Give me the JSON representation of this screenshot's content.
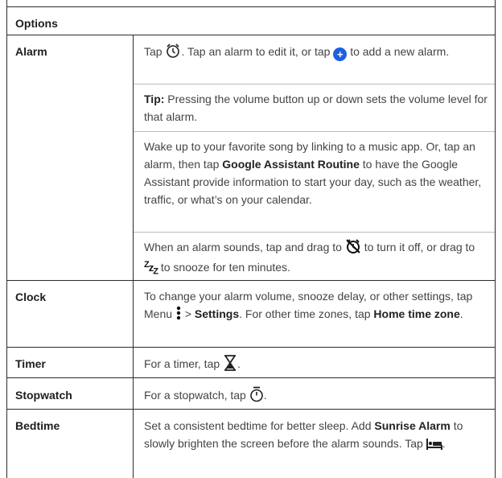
{
  "header": {
    "title": "Options"
  },
  "rows": {
    "alarm": {
      "label": "Alarm",
      "p1_a": "Tap ",
      "p1_b": ". Tap an alarm to edit it, or tap ",
      "p1_c": " to add a new alarm.",
      "tip_label": "Tip:",
      "tip_text": " Pressing the volume button up or down sets the volume level for that alarm.",
      "p3_a": "Wake up to your favorite song by linking to a music app. Or, tap an alarm, then tap ",
      "p3_bold": "Google Assistant Routine",
      "p3_b": " to have the Google Assistant provide information to start your day, such as the weather, traffic, or what’s on your calendar.",
      "p4_a": "When an alarm sounds, tap and drag to ",
      "p4_b": " to turn it off, or drag to ",
      "p4_c": " to snooze for ten minutes."
    },
    "clock": {
      "label": "Clock",
      "a": "To change your alarm volume, snooze delay, or other settings, tap Menu ",
      "b": " > ",
      "settings": "Settings",
      "c": ". For other time zones, tap ",
      "home": "Home time zone",
      "d": "."
    },
    "timer": {
      "label": "Timer",
      "a": "For a timer, tap ",
      "b": "."
    },
    "stopwatch": {
      "label": "Stopwatch",
      "a": "For a stopwatch, tap ",
      "b": "."
    },
    "bedtime": {
      "label": "Bedtime",
      "a": "Set a consistent bedtime for better sleep. Add ",
      "bold": "Sunrise Alarm",
      "b": " to slowly brighten the screen before the alarm sounds. Tap ",
      "c": "."
    }
  }
}
